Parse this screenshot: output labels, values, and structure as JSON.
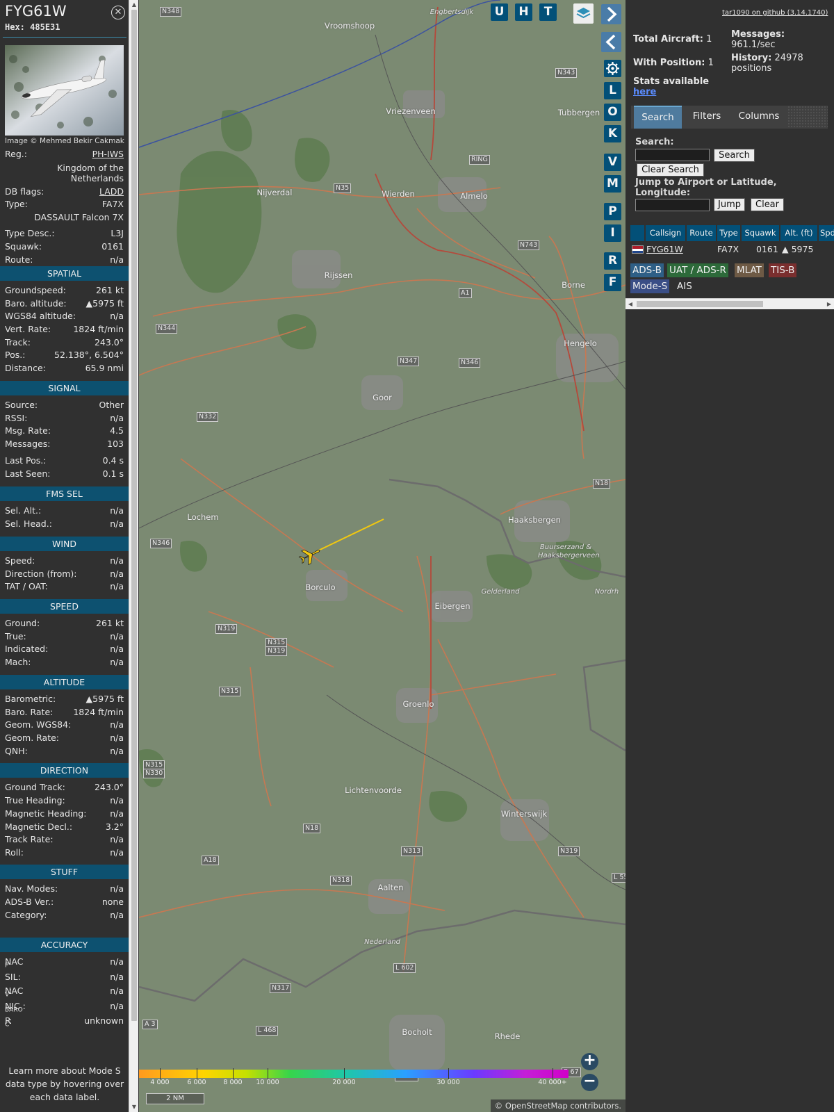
{
  "aircraft": {
    "callsign": "FYG61W",
    "hex_label": "Hex:",
    "hex": "485E31",
    "photo_credit": "Image © Mehmed Bekir Cakmak",
    "reg_label": "Reg.:",
    "reg": "PH-IWS",
    "country": "Kingdom of the Netherlands",
    "db_flags_label": "DB flags:",
    "db_flags": "LADD",
    "type_label": "Type:",
    "type": "FA7X",
    "type_full": "DASSAULT Falcon 7X",
    "type_desc_label": "Type Desc.:",
    "type_desc": "L3J",
    "squawk_label": "Squawk:",
    "squawk": "0161",
    "route_label": "Route:",
    "route": "n/a"
  },
  "sections": {
    "spatial": "SPATIAL",
    "signal": "SIGNAL",
    "fms": "FMS SEL",
    "wind": "WIND",
    "speed": "SPEED",
    "altitude": "ALTITUDE",
    "direction": "DIRECTION",
    "stuff": "STUFF",
    "accuracy": "ACCURACY"
  },
  "spatial": [
    {
      "label": "Groundspeed:",
      "value": "261 kt"
    },
    {
      "label": "Baro. altitude:",
      "value": "▲5975 ft"
    },
    {
      "label": "WGS84 altitude:",
      "value": "n/a"
    },
    {
      "label": "Vert. Rate:",
      "value": "1824 ft/min"
    },
    {
      "label": "Track:",
      "value": "243.0°"
    },
    {
      "label": "Pos.:",
      "value": "52.138°, 6.504°"
    },
    {
      "label": "Distance:",
      "value": "65.9 nmi"
    }
  ],
  "signal": [
    {
      "label": "Source:",
      "value": "Other"
    },
    {
      "label": "RSSI:",
      "value": "n/a"
    },
    {
      "label": "Msg. Rate:",
      "value": "4.5"
    },
    {
      "label": "Messages:",
      "value": "103"
    },
    {
      "label": "Last Pos.:",
      "value": "0.4 s"
    },
    {
      "label": "Last Seen:",
      "value": "0.1 s"
    }
  ],
  "fms": [
    {
      "label": "Sel. Alt.:",
      "value": "n/a"
    },
    {
      "label": "Sel. Head.:",
      "value": "n/a"
    }
  ],
  "wind": [
    {
      "label": "Speed:",
      "value": "n/a"
    },
    {
      "label": "Direction (from):",
      "value": "n/a"
    },
    {
      "label": "TAT / OAT:",
      "value": "n/a"
    }
  ],
  "speed": [
    {
      "label": "Ground:",
      "value": "261 kt"
    },
    {
      "label": "True:",
      "value": "n/a"
    },
    {
      "label": "Indicated:",
      "value": "n/a"
    },
    {
      "label": "Mach:",
      "value": "n/a"
    }
  ],
  "altitude": [
    {
      "label": "Barometric:",
      "value": "▲5975 ft"
    },
    {
      "label": "Baro. Rate:",
      "value": "1824 ft/min"
    },
    {
      "label": "Geom. WGS84:",
      "value": "n/a"
    },
    {
      "label": "Geom. Rate:",
      "value": "n/a"
    },
    {
      "label": "QNH:",
      "value": "n/a"
    }
  ],
  "direction": [
    {
      "label": "Ground Track:",
      "value": "243.0°"
    },
    {
      "label": "True Heading:",
      "value": "n/a"
    },
    {
      "label": "Magnetic Heading:",
      "value": "n/a"
    },
    {
      "label": "Magnetic Decl.:",
      "value": "3.2°"
    },
    {
      "label": "Track Rate:",
      "value": "n/a"
    },
    {
      "label": "Roll:",
      "value": "n/a"
    }
  ],
  "stuff": [
    {
      "label": "Nav. Modes:",
      "value": "n/a"
    },
    {
      "label": "ADS-B Ver.:",
      "value": "none"
    },
    {
      "label": "Category:",
      "value": "n/a"
    }
  ],
  "accuracy": [
    {
      "label": "NAC",
      "sub": "P",
      "value": "n/a"
    },
    {
      "label": "SIL:",
      "sub": "",
      "value": "n/a"
    },
    {
      "label": "NAC",
      "sub": "V",
      "value": "n/a"
    },
    {
      "label": "NIC",
      "sub": "BARO",
      "value": "n/a"
    },
    {
      "label": "R",
      "sub": "C",
      "value": "unknown"
    }
  ],
  "footnote": "Learn more about Mode S data type by hovering over each data label.",
  "map": {
    "buttons_top": [
      "U",
      "H",
      "T"
    ],
    "buttons_side": [
      "L",
      "O",
      "K",
      "V",
      "M",
      "P",
      "I",
      "R",
      "F"
    ],
    "places": [
      "Vroomshoop",
      "Vriezenveen",
      "Tubbergen",
      "Nijverdal",
      "Wierden",
      "Almelo",
      "Rijssen",
      "Borne",
      "Hengelo",
      "Goor",
      "Lochem",
      "Haaksbergen",
      "Buurserzand & Haaksbergerveen",
      "Borculo",
      "Eibergen",
      "Groenlo",
      "Lichtenvoorde",
      "Winterswijk",
      "Aalten",
      "Bocholt",
      "Rhede",
      "Engbertsdijk",
      "Gelderland",
      "Nederland",
      "Nordrh"
    ],
    "roads": [
      "N348",
      "N343",
      "RING",
      "N35",
      "N743",
      "A1",
      "N344",
      "N347",
      "N346",
      "N332",
      "N18",
      "N346",
      "N319",
      "N315",
      "N319",
      "N315",
      "N315",
      "N330",
      "N18",
      "N313",
      "A18",
      "N318",
      "N319",
      "L 55",
      "N317",
      "L 602",
      "A 3",
      "L 468",
      "B 473",
      "B 67"
    ],
    "alt_scale": [
      "4 000",
      "6 000",
      "8 000",
      "10 000",
      "20 000",
      "30 000",
      "40 000+"
    ],
    "scale_bar": "2 NM",
    "attribution_prefix": "© ",
    "attribution_link": "OpenStreetMap",
    "attribution_suffix": " contributors."
  },
  "sidebar": {
    "github_link": "tar1090 on github (3.14.1740)",
    "total_aircraft_label": "Total Aircraft:",
    "total_aircraft": "1",
    "with_position_label": "With Position:",
    "with_position": "1",
    "messages_label": "Messages:",
    "messages_rate": "961.1/sec",
    "history_label": "History:",
    "history_value": "24978",
    "history_unit": "positions",
    "stats_text": "Stats available",
    "stats_link": "here",
    "tabs": [
      "Search",
      "Filters",
      "Columns"
    ],
    "search_label": "Search:",
    "search_button": "Search",
    "clear_search_button": "Clear Search",
    "jump_label": "Jump to Airport or Latitude, Longitude:",
    "jump_button": "Jump",
    "clear_button": "Clear",
    "columns": [
      "",
      "Callsign",
      "Route",
      "Type",
      "Squawk",
      "Alt. (ft)",
      "Spd"
    ],
    "row": {
      "callsign": "FYG61W",
      "route": "",
      "type": "FA7X",
      "squawk": "0161",
      "alt": "▲ 5975"
    },
    "sources": [
      "ADS-B",
      "UAT / ADS-R",
      "MLAT",
      "TIS-B",
      "Mode-S",
      "AIS"
    ]
  },
  "colors": {
    "section_header": "#0d5170",
    "button_blue": "#035078",
    "track_line": "#f2c80f",
    "map_base": "#7b8a72"
  }
}
